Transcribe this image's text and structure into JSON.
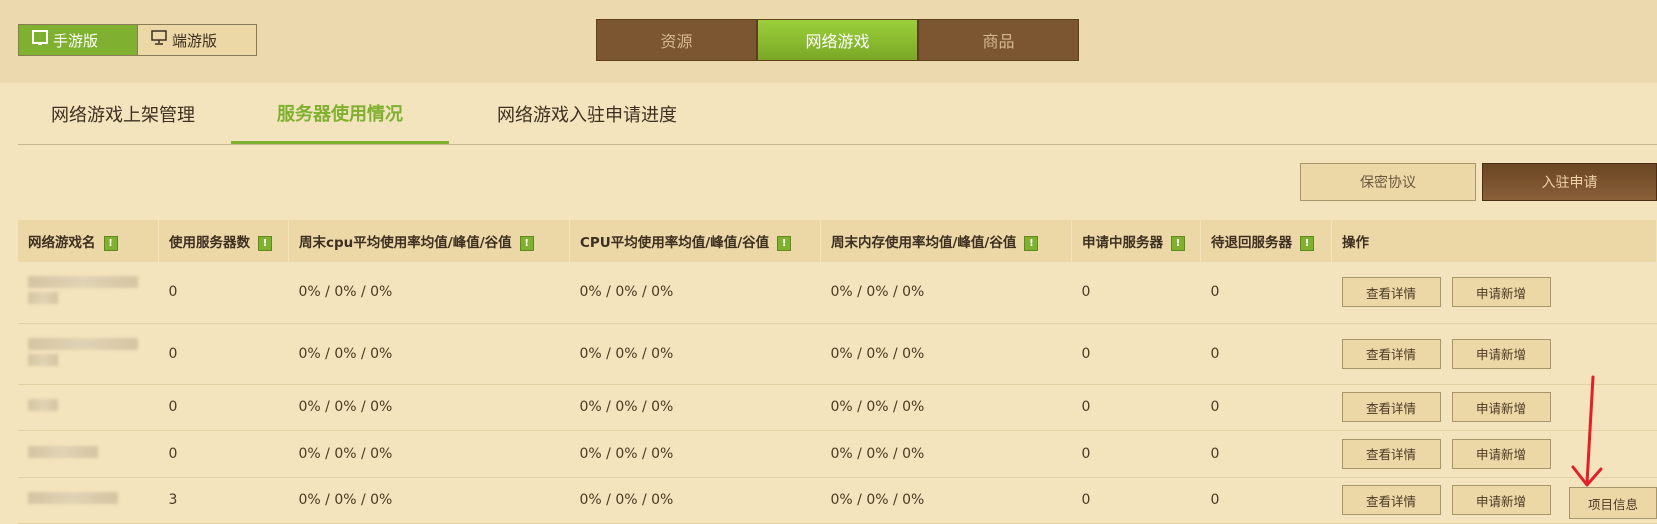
{
  "platform": {
    "mobile_label": "手游版",
    "pc_label": "端游版"
  },
  "categories": [
    "资源",
    "网络游戏",
    "商品"
  ],
  "subtabs": [
    "网络游戏上架管理",
    "服务器使用情况",
    "网络游戏入驻申请进度"
  ],
  "actions": {
    "nda_label": "保密协议",
    "apply_label": "入驻申请"
  },
  "table": {
    "headers": [
      "网络游戏名",
      "使用服务器数",
      "周末cpu平均使用率均值/峰值/谷值",
      "CPU平均使用率均值/峰值/谷值",
      "周末内存使用率均值/峰值/谷值",
      "申请中服务器",
      "待退回服务器",
      "操作"
    ],
    "info_mark": "!",
    "rows": [
      {
        "servers": "0",
        "weekend_cpu": "0% / 0% / 0%",
        "cpu": "0% / 0% / 0%",
        "weekend_mem": "0% / 0% / 0%",
        "applying": "0",
        "returning": "0"
      },
      {
        "servers": "0",
        "weekend_cpu": "0% / 0% / 0%",
        "cpu": "0% / 0% / 0%",
        "weekend_mem": "0% / 0% / 0%",
        "applying": "0",
        "returning": "0"
      },
      {
        "servers": "0",
        "weekend_cpu": "0% / 0% / 0%",
        "cpu": "0% / 0% / 0%",
        "weekend_mem": "0% / 0% / 0%",
        "applying": "0",
        "returning": "0"
      },
      {
        "servers": "0",
        "weekend_cpu": "0% / 0% / 0%",
        "cpu": "0% / 0% / 0%",
        "weekend_mem": "0% / 0% / 0%",
        "applying": "0",
        "returning": "0"
      },
      {
        "servers": "3",
        "weekend_cpu": "0% / 0% / 0%",
        "cpu": "0% / 0% / 0%",
        "weekend_mem": "0% / 0% / 0%",
        "applying": "0",
        "returning": "0"
      }
    ],
    "view_label": "查看详情",
    "add_label": "申请新增",
    "project_info_label": "项目信息"
  },
  "colors": {
    "accent_green": "#7fb02f",
    "brown": "#7b5631",
    "background": "#f4e4bd",
    "annotation_red": "#e0202a"
  }
}
